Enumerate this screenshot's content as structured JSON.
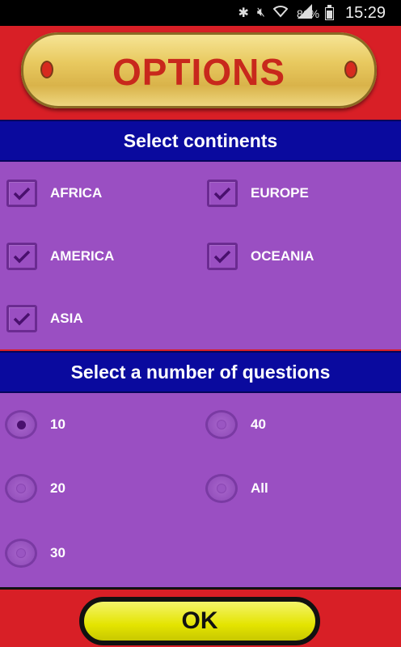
{
  "status_bar": {
    "battery_percent": "81%",
    "time": "15:29",
    "icons": [
      "bluetooth-icon",
      "mute-icon",
      "wifi-icon",
      "signal-icon",
      "battery-icon"
    ]
  },
  "header": {
    "title": "OPTIONS"
  },
  "continents": {
    "heading": "Select continents",
    "items": [
      {
        "label": "AFRICA",
        "checked": true
      },
      {
        "label": "EUROPE",
        "checked": true
      },
      {
        "label": "AMERICA",
        "checked": true
      },
      {
        "label": "OCEANIA",
        "checked": true
      },
      {
        "label": "ASIA",
        "checked": true
      }
    ]
  },
  "questions": {
    "heading": "Select a number of questions",
    "options": [
      {
        "label": "10",
        "selected": true
      },
      {
        "label": "40",
        "selected": false
      },
      {
        "label": "20",
        "selected": false
      },
      {
        "label": "All",
        "selected": false
      },
      {
        "label": "30",
        "selected": false
      }
    ]
  },
  "footer": {
    "ok_label": "OK"
  },
  "colors": {
    "background_red": "#d81f26",
    "section_blue": "#0a0a9e",
    "panel_purple": "#9a4fc2",
    "title_red": "#c8281c",
    "ok_yellow": "#e4e400"
  }
}
